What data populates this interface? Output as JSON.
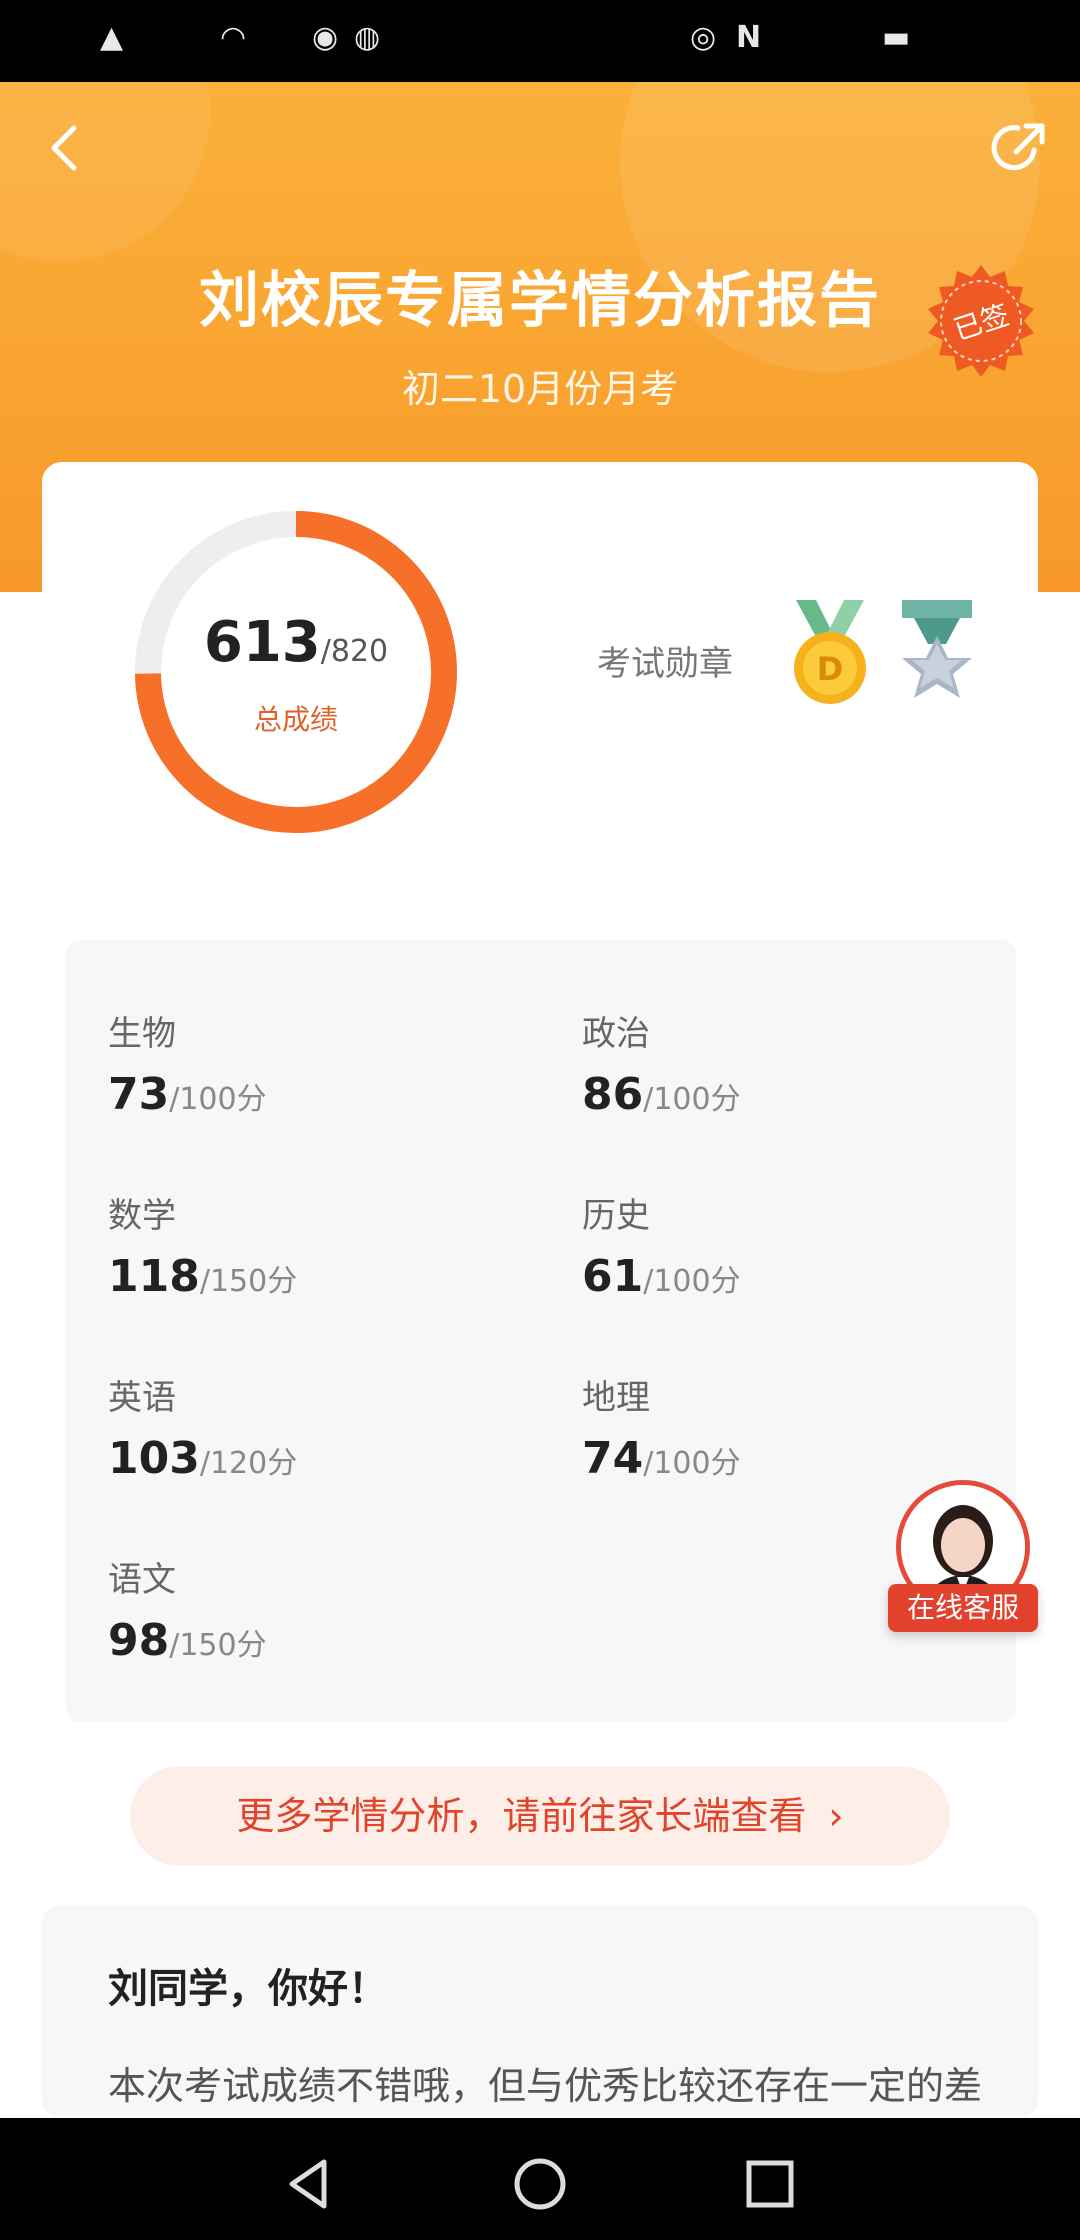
{
  "header": {
    "title": "刘校辰专属学情分析报告",
    "subtitle": "初二10月份月考",
    "stamp_text": "已签"
  },
  "score": {
    "total": "613",
    "max": "/820",
    "label": "总成绩",
    "fraction": 0.748
  },
  "medals": {
    "label": "考试勋章",
    "items": [
      "gold-medal-icon",
      "silver-star-medal-icon"
    ]
  },
  "subjects": [
    {
      "name": "生物",
      "score": "73",
      "total": "/100分"
    },
    {
      "name": "政治",
      "score": "86",
      "total": "/100分"
    },
    {
      "name": "数学",
      "score": "118",
      "total": "/150分"
    },
    {
      "name": "历史",
      "score": "61",
      "total": "/100分"
    },
    {
      "name": "英语",
      "score": "103",
      "total": "/120分"
    },
    {
      "name": "地理",
      "score": "74",
      "total": "/100分"
    },
    {
      "name": "语文",
      "score": "98",
      "total": "/150分"
    }
  ],
  "service": {
    "label": "在线客服"
  },
  "more": {
    "label": "更多学情分析，请前往家长端查看"
  },
  "letter": {
    "greeting": "刘同学，你好！",
    "body": "本次考试成绩不错哦，但与优秀比较还存在一定的差距"
  },
  "colors": {
    "header": "#f9a431",
    "ring": "#f7702a",
    "accent": "#e0452c"
  }
}
